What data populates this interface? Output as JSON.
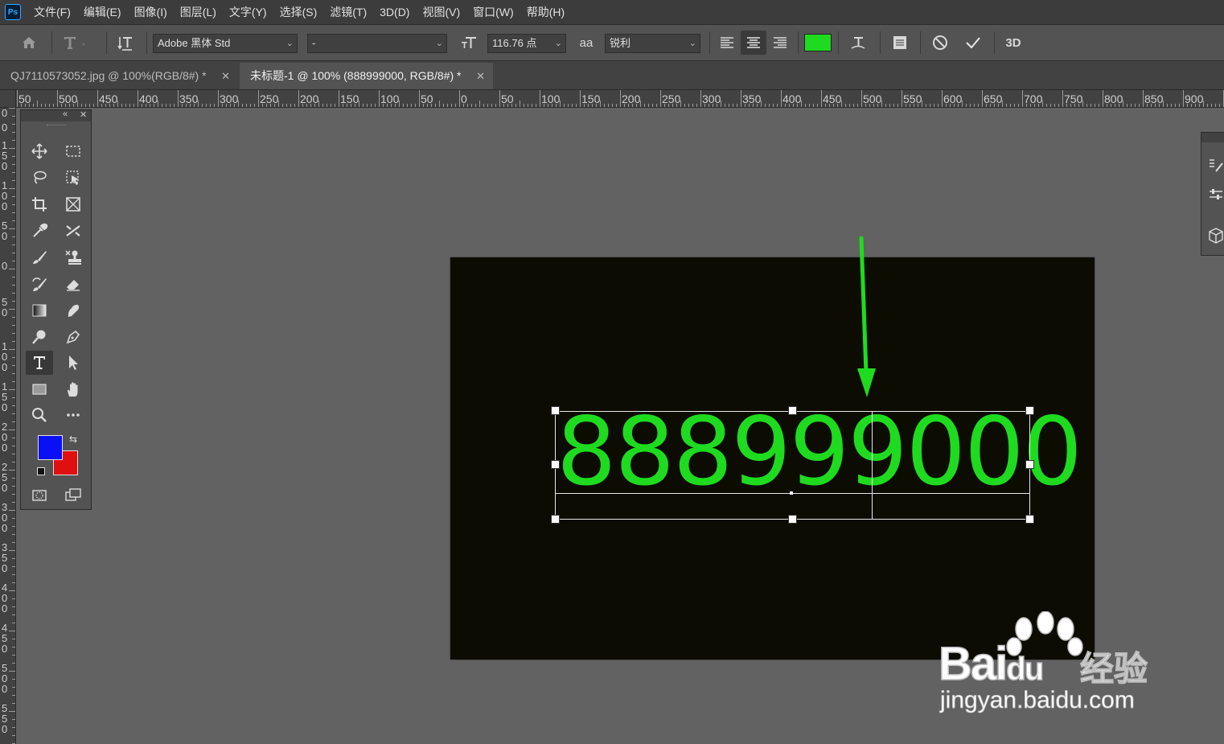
{
  "app": {
    "logo": "Ps"
  },
  "menu": [
    "文件(F)",
    "编辑(E)",
    "图像(I)",
    "图层(L)",
    "文字(Y)",
    "选择(S)",
    "滤镜(T)",
    "3D(D)",
    "视图(V)",
    "窗口(W)",
    "帮助(H)"
  ],
  "options": {
    "font_family": "Adobe 黑体 Std",
    "font_style": "-",
    "font_size": "116.76 点",
    "aa_label": "aa",
    "antialias": "锐利",
    "text_color": "#1fdb1f",
    "three_d_label": "3D"
  },
  "tabs": [
    {
      "label": "QJ7110573052.jpg @ 100%(RGB/8#) *",
      "active": false
    },
    {
      "label": "未标题-1 @ 100% (888999000, RGB/8#) *",
      "active": true
    }
  ],
  "ruler": {
    "h_labels": [
      "50",
      "500",
      "450",
      "400",
      "350",
      "300",
      "250",
      "200",
      "150",
      "100",
      "50",
      "0",
      "50",
      "100",
      "150",
      "200",
      "250",
      "300",
      "350",
      "400",
      "450",
      "500",
      "550",
      "600",
      "650",
      "700",
      "750",
      "800",
      "850",
      "900",
      "95"
    ],
    "v_labels": [
      "0",
      "0",
      "1\n5\n0",
      "1\n0\n0",
      "5\n0",
      "0",
      "5\n0",
      "1\n0\n0",
      "1\n5\n0",
      "2\n0\n0",
      "2\n5\n0",
      "3\n0\n0",
      "3\n5\n0",
      "4\n0\n0",
      "4\n5\n0",
      "5\n0\n0",
      "5\n5\n0"
    ]
  },
  "canvas": {
    "text": "888999000",
    "background": "#0c0c02",
    "text_color": "#1fdb1f",
    "arrow_color": "#1fdb1f"
  },
  "toolbox": {
    "foreground": "#0a10f5",
    "background": "#e01010"
  },
  "watermark": {
    "brand": "Bai",
    "brand2": "du",
    "cn": "经验",
    "url": "jingyan.baidu.com"
  }
}
